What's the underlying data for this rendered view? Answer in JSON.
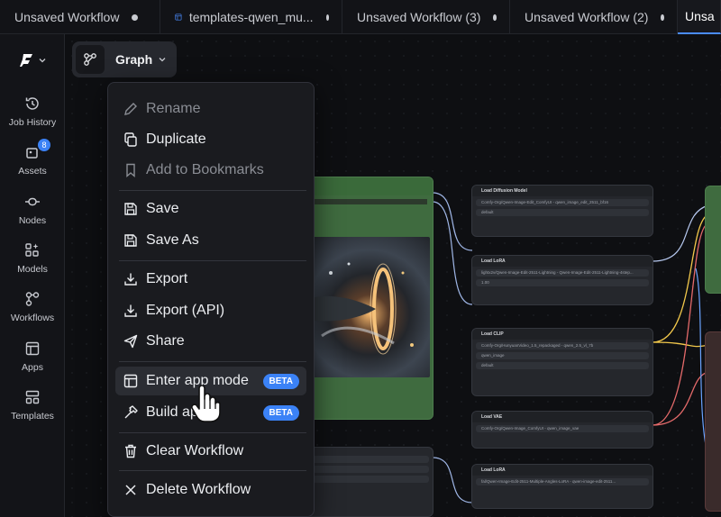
{
  "tabs": [
    {
      "label": "Unsaved Workflow",
      "active": false,
      "icon": null
    },
    {
      "label": "templates-qwen_mu...",
      "active": false,
      "icon": "workflow-icon"
    },
    {
      "label": "Unsaved Workflow (3)",
      "active": false,
      "icon": null
    },
    {
      "label": "Unsaved Workflow (2)",
      "active": false,
      "icon": null
    },
    {
      "label": "Unsa",
      "active": true,
      "icon": null
    }
  ],
  "sidebar": {
    "items": [
      {
        "label": "Job History",
        "icon": "history-icon"
      },
      {
        "label": "Assets",
        "icon": "assets-icon",
        "badge": "8"
      },
      {
        "label": "Nodes",
        "icon": "nodes-icon"
      },
      {
        "label": "Models",
        "icon": "models-icon"
      },
      {
        "label": "Workflows",
        "icon": "workflows-icon"
      },
      {
        "label": "Apps",
        "icon": "apps-icon"
      },
      {
        "label": "Templates",
        "icon": "templates-icon"
      }
    ]
  },
  "graph_button": {
    "label": "Graph"
  },
  "menu": {
    "items": [
      {
        "label": "Rename",
        "icon": "pencil-icon",
        "disabled": true
      },
      {
        "label": "Duplicate",
        "icon": "copy-icon",
        "disabled": false
      },
      {
        "label": "Add to Bookmarks",
        "icon": "bookmark-icon",
        "disabled": true
      },
      {
        "label": "Save",
        "icon": "save-icon",
        "disabled": false
      },
      {
        "label": "Save As",
        "icon": "save-as-icon",
        "disabled": false
      },
      {
        "label": "Export",
        "icon": "download-icon",
        "disabled": false
      },
      {
        "label": "Export (API)",
        "icon": "download-api-icon",
        "disabled": false
      },
      {
        "label": "Share",
        "icon": "send-icon",
        "disabled": false
      },
      {
        "label": "Enter app mode",
        "icon": "app-mode-icon",
        "badge": "BETA",
        "hover": true
      },
      {
        "label": "Build ap",
        "icon": "hammer-icon",
        "badge": "BETA"
      },
      {
        "label": "Clear Workflow",
        "icon": "trash-icon",
        "disabled": false
      },
      {
        "label": "Delete Workflow",
        "icon": "x-icon",
        "disabled": false
      }
    ]
  },
  "nodes": {
    "diffusion": {
      "title": "Load Diffusion Model",
      "r1": "Comfy-Org/Qwen-Image-Edit_ComfyUI - qwen_image_edit_2511_bf16",
      "r2": "default"
    },
    "lora1": {
      "title": "Load LoRA",
      "r1": "lightx2v/Qwen-Image-Edit-2511-Lightning - Qwen-Image-Edit-2511-Lightning-4step...",
      "r2": "1.00"
    },
    "clip": {
      "title": "Load CLIP",
      "r1": "Comfy-Org/HunyuanVideo_1.5_repackaged - qwen_2.5_vl_7b",
      "r2": "qwen_image",
      "r3": "default"
    },
    "vae": {
      "title": "Load VAE",
      "r1": "Comfy-Org/Qwen-Image_ComfyUI - qwen_image_vae"
    },
    "lora2": {
      "title": "Load LoRA",
      "r1": "fal/Qwen-Image-Edit-2511-Multiple-Angles-LoRA - qwen-image-edit-2511..."
    }
  },
  "colors": {
    "accent": "#3b82f6",
    "node_green": "#3f6b3f"
  }
}
